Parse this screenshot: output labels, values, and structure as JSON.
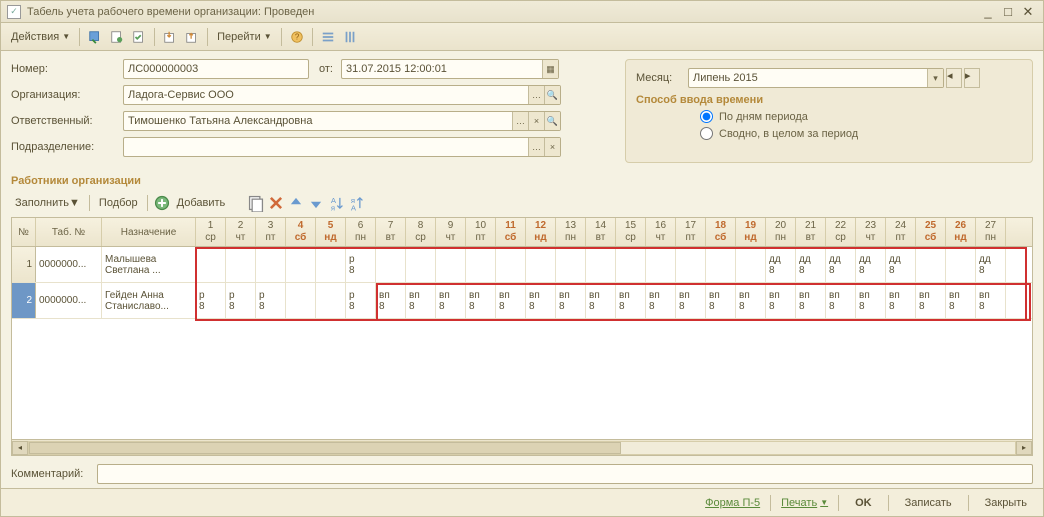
{
  "window": {
    "title": "Табель учета рабочего времени организации: Проведен"
  },
  "toolbar": {
    "actions": "Действия",
    "goto": "Перейти"
  },
  "form": {
    "number_label": "Номер:",
    "number": "ЛС000000003",
    "date_label": "от:",
    "date": "31.07.2015 12:00:01",
    "org_label": "Организация:",
    "org": "Ладога-Сервис ООО",
    "resp_label": "Ответственный:",
    "resp": "Тимошенко Татьяна Александровна",
    "dept_label": "Подразделение:",
    "dept": ""
  },
  "right": {
    "month_label": "Месяц:",
    "month": "Липень 2015",
    "method_title": "Способ ввода времени",
    "radio1": "По дням периода",
    "radio2": "Сводно, в целом за период"
  },
  "section_title": "Работники организации",
  "subtoolbar": {
    "fill": "Заполнить",
    "pick": "Подбор",
    "add": "Добавить"
  },
  "grid": {
    "headers": {
      "num": "№",
      "tab": "Таб. №",
      "name": "Назначение"
    },
    "days": [
      {
        "n": "1",
        "w": "ср",
        "we": false
      },
      {
        "n": "2",
        "w": "чт",
        "we": false
      },
      {
        "n": "3",
        "w": "пт",
        "we": false
      },
      {
        "n": "4",
        "w": "сб",
        "we": true
      },
      {
        "n": "5",
        "w": "нд",
        "we": true
      },
      {
        "n": "6",
        "w": "пн",
        "we": false
      },
      {
        "n": "7",
        "w": "вт",
        "we": false
      },
      {
        "n": "8",
        "w": "ср",
        "we": false
      },
      {
        "n": "9",
        "w": "чт",
        "we": false
      },
      {
        "n": "10",
        "w": "пт",
        "we": false
      },
      {
        "n": "11",
        "w": "сб",
        "we": true
      },
      {
        "n": "12",
        "w": "нд",
        "we": true
      },
      {
        "n": "13",
        "w": "пн",
        "we": false
      },
      {
        "n": "14",
        "w": "вт",
        "we": false
      },
      {
        "n": "15",
        "w": "ср",
        "we": false
      },
      {
        "n": "16",
        "w": "чт",
        "we": false
      },
      {
        "n": "17",
        "w": "пт",
        "we": false
      },
      {
        "n": "18",
        "w": "сб",
        "we": true
      },
      {
        "n": "19",
        "w": "нд",
        "we": true
      },
      {
        "n": "20",
        "w": "пн",
        "we": false
      },
      {
        "n": "21",
        "w": "вт",
        "we": false
      },
      {
        "n": "22",
        "w": "ср",
        "we": false
      },
      {
        "n": "23",
        "w": "чт",
        "we": false
      },
      {
        "n": "24",
        "w": "пт",
        "we": false
      },
      {
        "n": "25",
        "w": "сб",
        "we": true
      },
      {
        "n": "26",
        "w": "нд",
        "we": true
      },
      {
        "n": "27",
        "w": "пн",
        "we": false
      }
    ],
    "rows": [
      {
        "num": "1",
        "tab": "0000000...",
        "name1": "Малышева",
        "name2": "Светлана ...",
        "cells": [
          "",
          "",
          "",
          "",
          "",
          "р 8",
          "",
          "",
          "",
          "",
          "",
          "",
          "",
          "",
          "",
          "",
          "",
          "",
          "",
          "дд 8",
          "дд 8",
          "дд 8",
          "дд 8",
          "дд 8",
          "",
          "",
          "дд 8"
        ]
      },
      {
        "num": "2",
        "tab": "0000000...",
        "name1": "Гейден Анна",
        "name2": "Станиславо...",
        "cells": [
          "р 8",
          "р 8",
          "р 8",
          "",
          "",
          "р 8",
          "вп 8",
          "вп 8",
          "вп 8",
          "вп 8",
          "вп 8",
          "вп 8",
          "вп 8",
          "вп 8",
          "вп 8",
          "вп 8",
          "вп 8",
          "вп 8",
          "вп 8",
          "вп 8",
          "вп 8",
          "вп 8",
          "вп 8",
          "вп 8",
          "вп 8",
          "вп 8",
          "вп 8"
        ]
      }
    ]
  },
  "comment_label": "Комментарий:",
  "comment": "",
  "footer": {
    "form": "Форма П-5",
    "print": "Печать",
    "ok": "OK",
    "save": "Записать",
    "close": "Закрыть"
  }
}
